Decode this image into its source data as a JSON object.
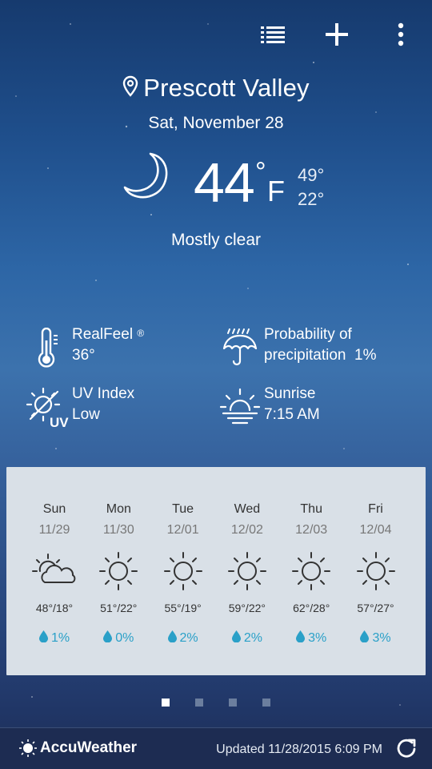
{
  "header": {
    "list_icon": "list-icon",
    "add_icon": "plus-icon",
    "menu_icon": "more-vert-icon"
  },
  "location": {
    "city": "Prescott Valley",
    "date": "Sat, November 28",
    "pin_icon": "location-pin-icon"
  },
  "current": {
    "icon": "moon-icon",
    "temp": "44",
    "deg_symbol": "°",
    "unit": "F",
    "high": "49°",
    "low": "22°",
    "condition": "Mostly clear"
  },
  "details": {
    "realfeel_label": "RealFeel",
    "realfeel_sup": "®",
    "realfeel_value": "36°",
    "precip_label_1": "Probability of",
    "precip_label_2": "precipitation",
    "precip_value": "1%",
    "uv_label": "UV Index",
    "uv_value": "Low",
    "uv_icon_text": "UV",
    "sunrise_label": "Sunrise",
    "sunrise_value": "7:15 AM"
  },
  "forecast": [
    {
      "day": "Sun",
      "date": "11/29",
      "icon": "partly-cloudy-icon",
      "temps": "48°/18°",
      "precip": "1%"
    },
    {
      "day": "Mon",
      "date": "11/30",
      "icon": "sun-icon",
      "temps": "51°/22°",
      "precip": "0%"
    },
    {
      "day": "Tue",
      "date": "12/01",
      "icon": "sun-icon",
      "temps": "55°/19°",
      "precip": "2%"
    },
    {
      "day": "Wed",
      "date": "12/02",
      "icon": "sun-icon",
      "temps": "59°/22°",
      "precip": "2%"
    },
    {
      "day": "Thu",
      "date": "12/03",
      "icon": "sun-icon",
      "temps": "62°/28°",
      "precip": "3%"
    },
    {
      "day": "Fri",
      "date": "12/04",
      "icon": "sun-icon",
      "temps": "57°/27°",
      "precip": "3%"
    }
  ],
  "pager": {
    "count": 4,
    "active": 0
  },
  "footer": {
    "brand": "AccuWeather",
    "updated": "Updated 11/28/2015 6:09 PM",
    "refresh_icon": "refresh-icon"
  },
  "colors": {
    "precip_accent": "#2aa0c8",
    "forecast_panel": "#d9e0e7",
    "footer_bg": "#1d2c52"
  }
}
